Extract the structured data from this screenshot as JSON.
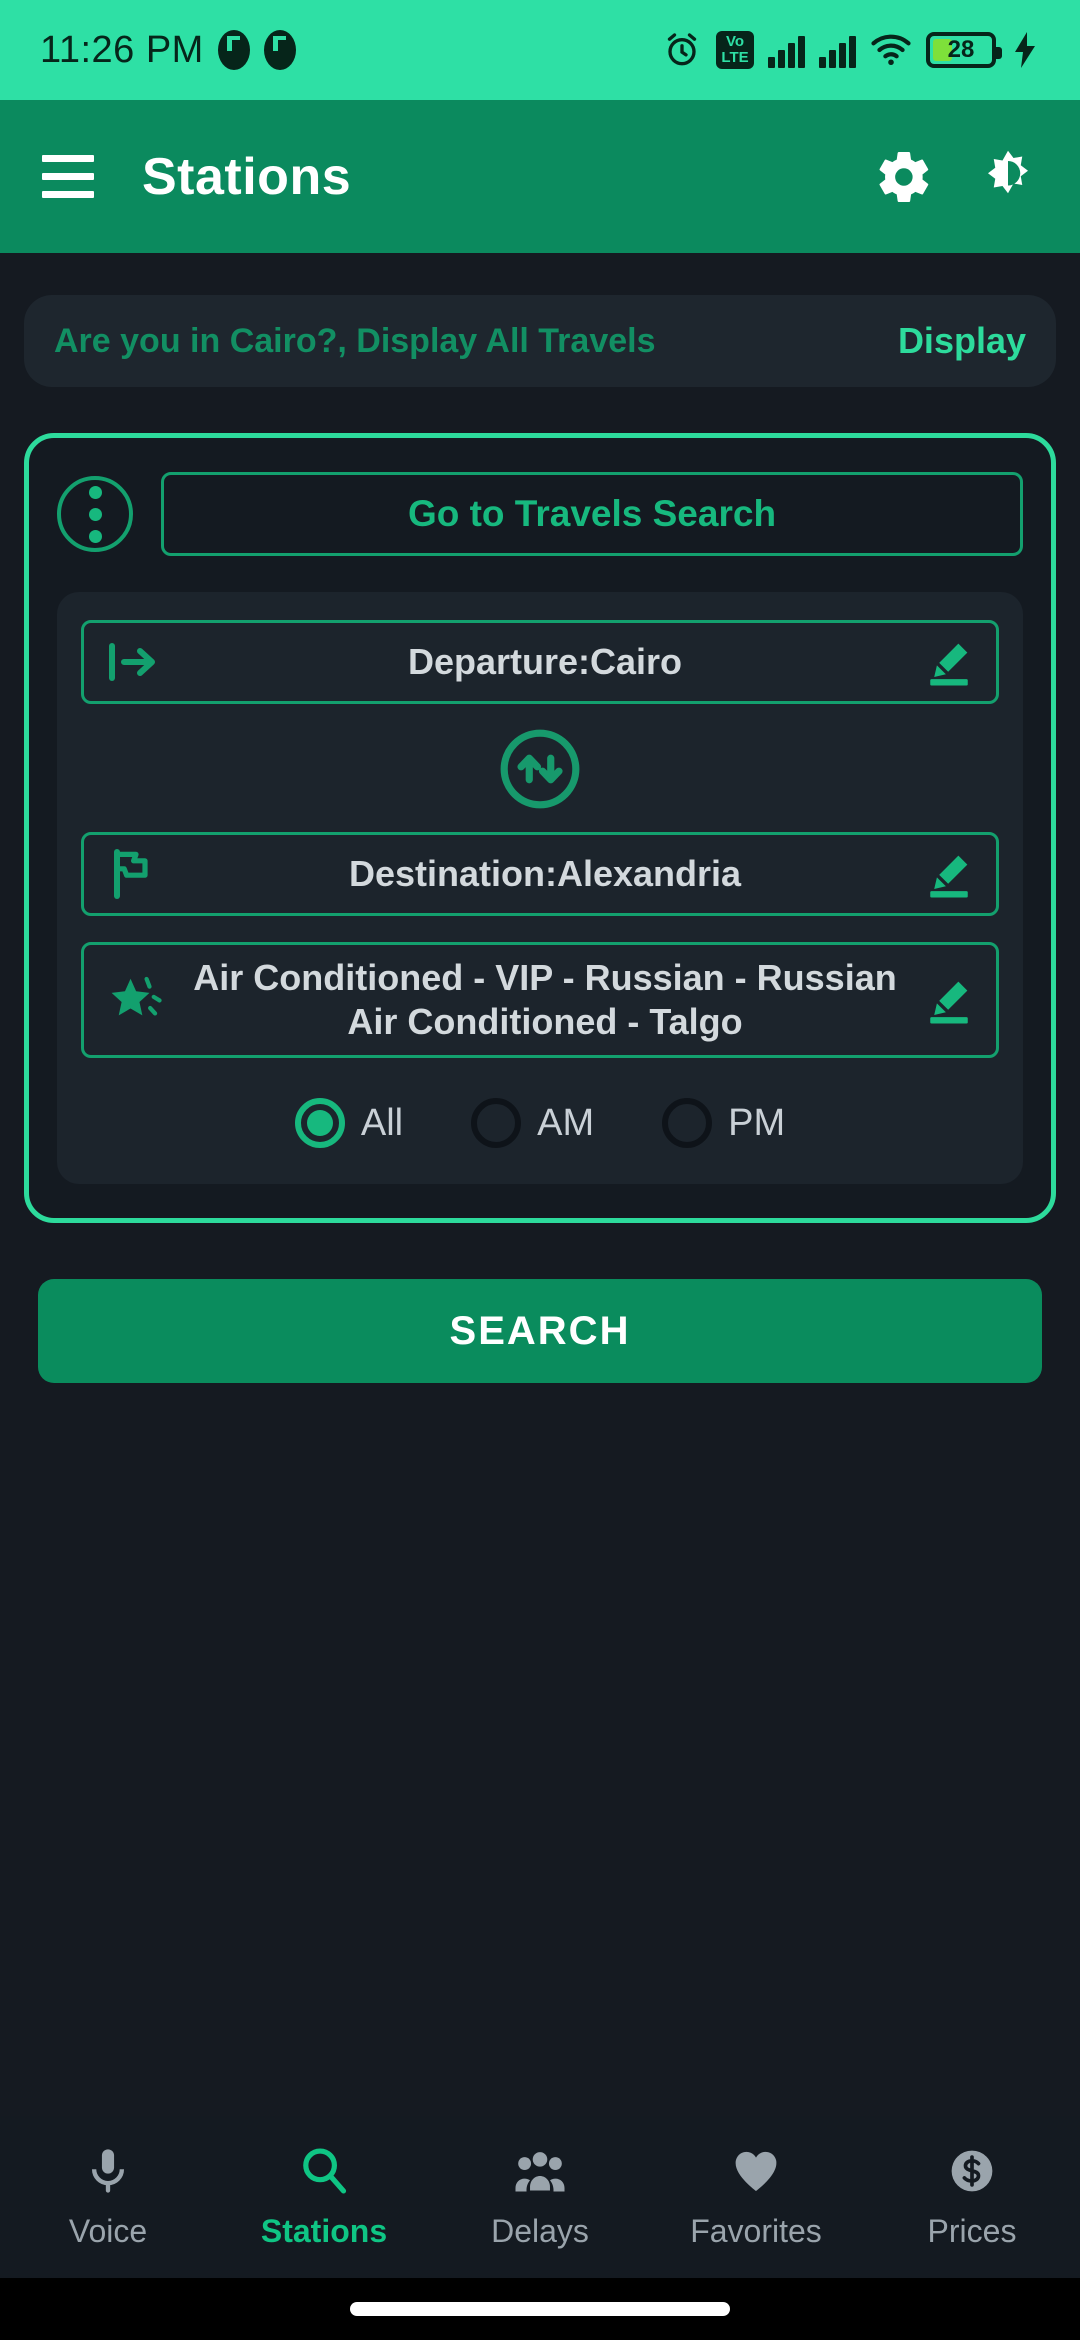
{
  "status_bar": {
    "time": "11:26 PM",
    "battery_percent": "28",
    "icons": [
      "alarm-icon",
      "dnd-icon",
      "dnd-icon",
      "volte-icon",
      "signal-icon",
      "signal-icon",
      "wifi-icon",
      "battery-icon",
      "charging-bolt-icon"
    ],
    "volte_top": "Vo",
    "volte_bottom": "LTE",
    "background": "#2ee0a5"
  },
  "appbar": {
    "title": "Stations",
    "menu_icon": "hamburger-menu-icon",
    "settings_icon": "gear-icon",
    "theme_icon": "brightness-toggle-icon",
    "background": "#0b8a5e"
  },
  "banner": {
    "text": "Are you in Cairo?, Display All Travels",
    "action_label": "Display"
  },
  "search_card": {
    "overflow_icon": "three-dots-vertical-icon",
    "travels_search_label": "Go to Travels Search",
    "fields": [
      {
        "name": "departure",
        "icon": "exit-arrow-icon",
        "value": "Departure:Cairo",
        "edit_icon": "pencil-edit-icon"
      },
      {
        "name": "destination",
        "icon": "flag-icon",
        "value": "Destination:Alexandria",
        "edit_icon": "pencil-edit-icon"
      },
      {
        "name": "train-types",
        "icon": "star-icon",
        "value": "Air Conditioned - VIP - Russian - Russian Air Conditioned - Talgo",
        "edit_icon": "pencil-edit-icon"
      }
    ],
    "swap_icon": "swap-vertical-circle-icon",
    "time_filter": {
      "options": [
        {
          "label": "All",
          "selected": true
        },
        {
          "label": "AM",
          "selected": false
        },
        {
          "label": "PM",
          "selected": false
        }
      ]
    }
  },
  "search_button": {
    "label": "SEARCH"
  },
  "bottom_nav": {
    "items": [
      {
        "label": "Voice",
        "icon": "microphone-icon",
        "active": false
      },
      {
        "label": "Stations",
        "icon": "search-icon",
        "active": true
      },
      {
        "label": "Delays",
        "icon": "people-group-icon",
        "active": false
      },
      {
        "label": "Favorites",
        "icon": "heart-icon",
        "active": false
      },
      {
        "label": "Prices",
        "icon": "dollar-circle-icon",
        "active": false
      }
    ]
  },
  "colors": {
    "accent_mint": "#2ddb9c",
    "accent_green": "#17b87e",
    "appbar_green": "#0b8a5e",
    "background": "#151a21",
    "panel": "#1c242c"
  }
}
